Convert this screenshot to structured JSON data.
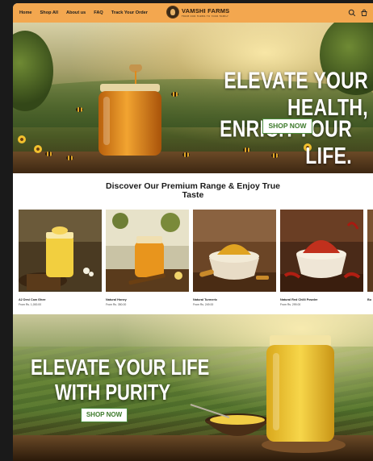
{
  "header": {
    "nav": [
      "Home",
      "Shop All",
      "About us",
      "FAQ",
      "Track Your Order"
    ],
    "logo_name": "VAMSHI FARMS",
    "logo_tagline": "FROM OUR FARMS TO YOUR FAMILY",
    "icons": [
      "search-icon",
      "cart-icon"
    ]
  },
  "hero1": {
    "line1": "ELEVATE YOUR HEALTH,",
    "line2": "ENRICH YOUR LIFE.",
    "cta": "SHOP NOW"
  },
  "section": {
    "title_line1": "Discover Our Premium Range & Enjoy True",
    "title_line2": "Taste"
  },
  "products": [
    {
      "name": "A2 Desi Cow Ghee",
      "price": "From Rs. 1,000.00"
    },
    {
      "name": "Natural Honey",
      "price": "From Rs. 350.00"
    },
    {
      "name": "Natural Turmeric",
      "price": "From Rs. 249.00"
    },
    {
      "name": "Natural Red Chilli Powder",
      "price": "From Rs. 299.00"
    },
    {
      "name": "Bu",
      "price": ""
    }
  ],
  "hero2": {
    "line1": "ELEVATE YOUR LIFE",
    "line2": "WITH PURITY",
    "cta": "SHOP NOW"
  },
  "colors": {
    "header_bg": "#f3a74f",
    "cta_text": "#3d7a2b",
    "honey": "#e4921c",
    "ghee": "#f2cf3f"
  }
}
